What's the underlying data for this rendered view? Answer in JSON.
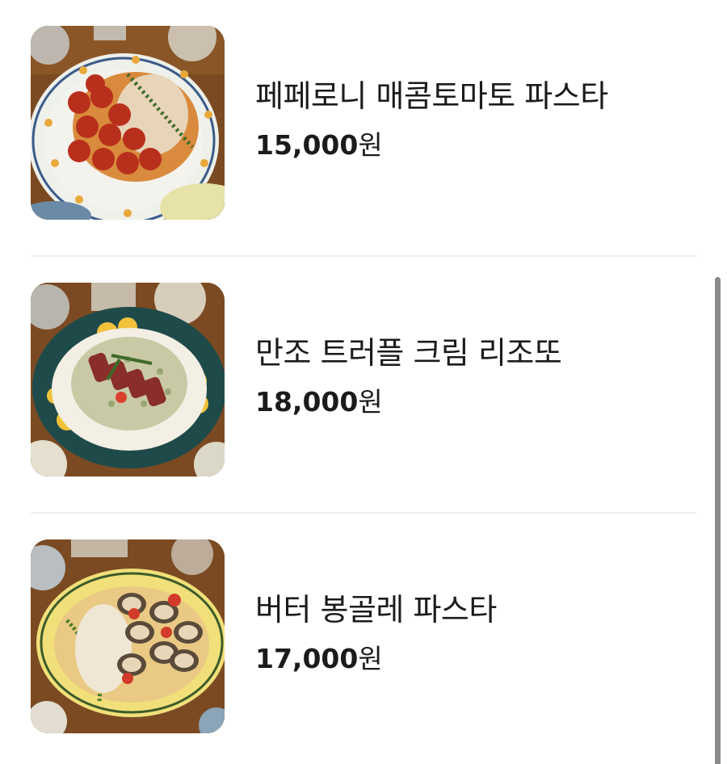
{
  "menu": {
    "items": [
      {
        "name": "페페로니 매콤토마토 파스타",
        "price": "15,000",
        "unit": "원"
      },
      {
        "name": "만조 트러플 크림 리조또",
        "price": "18,000",
        "unit": "원"
      },
      {
        "name": "버터 봉골레 파스타",
        "price": "17,000",
        "unit": "원"
      }
    ]
  },
  "colors": {
    "text": "#1b1b1b",
    "divider": "#f0f0f0",
    "scrollbar": "#8a8a8a",
    "table_wood": "#7a4a22"
  }
}
